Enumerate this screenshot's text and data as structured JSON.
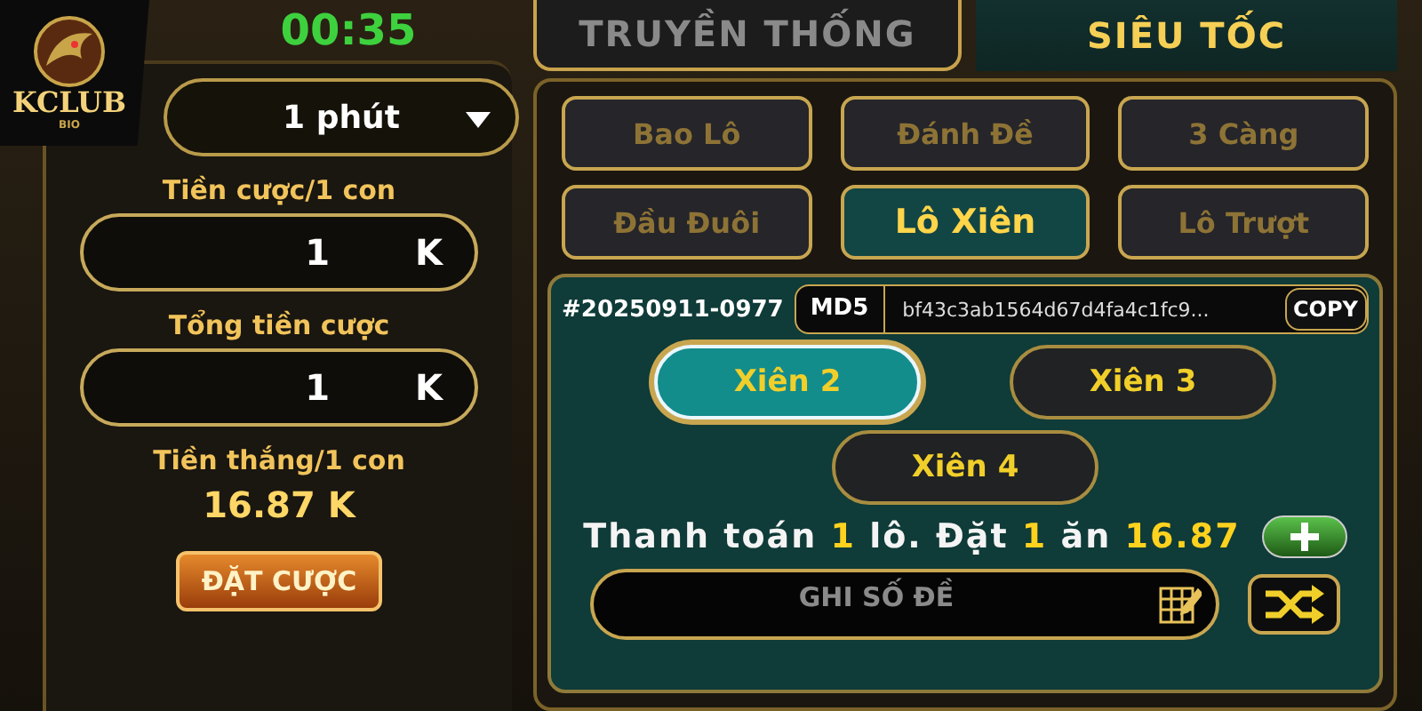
{
  "logo": {
    "title": "KCLUB",
    "subtitle": "BIO"
  },
  "timer": "00:35",
  "period": {
    "value": "1 phút"
  },
  "fields": [
    {
      "label": "Tiền cược/1 con",
      "value": "1",
      "unit": "K"
    },
    {
      "label": "Tổng tiền cược",
      "value": "1",
      "unit": "K"
    }
  ],
  "win": {
    "label": "Tiền thắng/1 con",
    "value": "16.87 K"
  },
  "place_bet": "ĐẶT CƯỢC",
  "mode_tabs": [
    {
      "label": "TRUYỀN THỐNG",
      "selected": false
    },
    {
      "label": "SIÊU TỐC",
      "selected": true
    }
  ],
  "bet_types": [
    {
      "label": "Bao Lô",
      "selected": false
    },
    {
      "label": "Đánh Đề",
      "selected": false
    },
    {
      "label": "3 Càng",
      "selected": false
    },
    {
      "label": "Đầu Đuôi",
      "selected": false
    },
    {
      "label": "Lô Xiên",
      "selected": true
    },
    {
      "label": "Lô Trượt",
      "selected": false
    }
  ],
  "round": {
    "id": "#20250911-0977",
    "hash_label": "MD5",
    "hash": "bf43c3ab1564d67d4fa4c1fc9...",
    "copy": "COPY"
  },
  "xien": [
    {
      "label": "Xiên 2",
      "selected": true
    },
    {
      "label": "Xiên 3",
      "selected": false
    },
    {
      "label": "Xiên 4",
      "selected": false
    }
  ],
  "summary": "Thanh toán **1** lô. Đặt **1** ăn **16.87**",
  "number_input": {
    "placeholder": "GHI SỐ ĐỀ"
  }
}
